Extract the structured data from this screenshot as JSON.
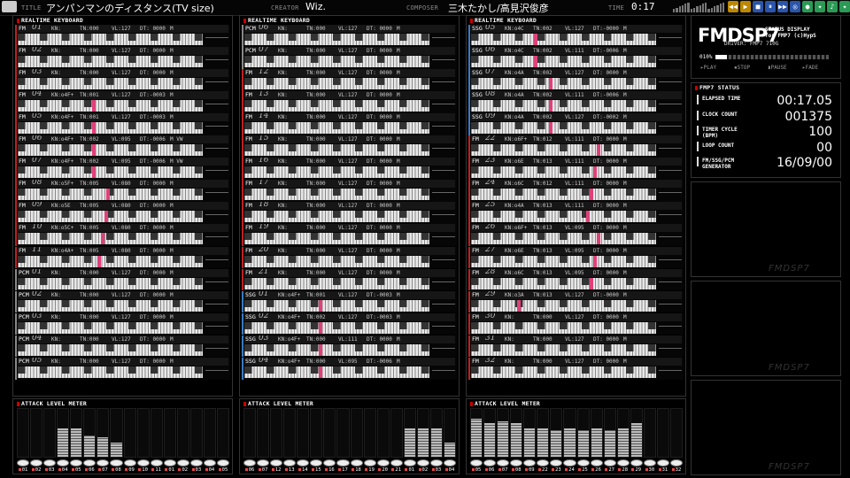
{
  "header": {
    "title_label": "TITLE",
    "title": "アンパンマンのディスタンス(TV size)",
    "creator_label": "CREATOR",
    "creator": "Wiz.",
    "composer_label": "COMPOSER",
    "composer": "三木たかし/高見沢俊彦",
    "time_label": "TIME",
    "time": "0:17"
  },
  "player_buttons": [
    "◀◀",
    "▶",
    "■",
    "⏸",
    "▶▶",
    "◎",
    "●",
    "✦",
    "♪",
    "✦",
    "▤",
    "▣",
    "✕"
  ],
  "panel_title": "REALTIME KEYBOARD",
  "meter_title": "ATTACK LEVEL METER",
  "channels": [
    [
      {
        "ch": "FM",
        "num": "01",
        "kn": "KN:",
        "tn": "TN:000",
        "vl": "VL:127",
        "dt": "DT: 0000",
        "fl": "M",
        "note": null
      },
      {
        "ch": "FM",
        "num": "02",
        "kn": "KN:",
        "tn": "TN:000",
        "vl": "VL:127",
        "dt": "DT: 0000",
        "fl": "M",
        "note": null
      },
      {
        "ch": "FM",
        "num": "03",
        "kn": "KN:",
        "tn": "TN:000",
        "vl": "VL:127",
        "dt": "DT: 0000",
        "fl": "M",
        "note": null
      },
      {
        "ch": "FM",
        "num": "04",
        "kn": "KN:o4F+",
        "tn": "TN:001",
        "vl": "VL:127",
        "dt": "DT:-0003",
        "fl": "M",
        "note": 0.4
      },
      {
        "ch": "FM",
        "num": "05",
        "kn": "KN:o4F+",
        "tn": "TN:001",
        "vl": "VL:127",
        "dt": "DT:-0003",
        "fl": "M",
        "note": 0.4
      },
      {
        "ch": "FM",
        "num": "06",
        "kn": "KN:o4F+",
        "tn": "TN:002",
        "vl": "VL:095",
        "dt": "DT:-0006",
        "fl": "M VW",
        "note": 0.4
      },
      {
        "ch": "FM",
        "num": "07",
        "kn": "KN:o4F+",
        "tn": "TN:002",
        "vl": "VL:095",
        "dt": "DT:-0006",
        "fl": "M VW",
        "note": 0.4
      },
      {
        "ch": "FM",
        "num": "08",
        "kn": "KN:o5F+",
        "tn": "TN:005",
        "vl": "VL:080",
        "dt": "DT: 0000",
        "fl": "M",
        "note": 0.48
      },
      {
        "ch": "FM",
        "num": "09",
        "kn": "KN:o5E",
        "tn": "TN:005",
        "vl": "VL:080",
        "dt": "DT: 0000",
        "fl": "M",
        "note": 0.47
      },
      {
        "ch": "FM",
        "num": "10",
        "kn": "KN:o5C+",
        "tn": "TN:005",
        "vl": "VL:080",
        "dt": "DT: 0000",
        "fl": "M",
        "note": 0.45
      },
      {
        "ch": "FM",
        "num": "11",
        "kn": "KN:o4A+",
        "tn": "TN:005",
        "vl": "VL:080",
        "dt": "DT: 0000",
        "fl": "M",
        "note": 0.43
      },
      {
        "ch": "PCM",
        "num": "01",
        "kn": "KN:",
        "tn": "TN:000",
        "vl": "VL:127",
        "dt": "DT: 0000",
        "fl": "M",
        "note": null
      },
      {
        "ch": "PCM",
        "num": "02",
        "kn": "KN:",
        "tn": "TN:000",
        "vl": "VL:127",
        "dt": "DT: 0000",
        "fl": "M",
        "note": null
      },
      {
        "ch": "PCM",
        "num": "03",
        "kn": "KN:",
        "tn": "TN:000",
        "vl": "VL:127",
        "dt": "DT: 0000",
        "fl": "M",
        "note": null
      },
      {
        "ch": "PCM",
        "num": "04",
        "kn": "KN:",
        "tn": "TN:000",
        "vl": "VL:127",
        "dt": "DT: 0000",
        "fl": "M",
        "note": null
      },
      {
        "ch": "PCM",
        "num": "05",
        "kn": "KN:",
        "tn": "TN:000",
        "vl": "VL:127",
        "dt": "DT: 0000",
        "fl": "M",
        "note": null
      }
    ],
    [
      {
        "ch": "PCM",
        "num": "06",
        "kn": "KN:",
        "tn": "TN:000",
        "vl": "VL:127",
        "dt": "DT: 0000",
        "fl": "M",
        "note": null
      },
      {
        "ch": "PCM",
        "num": "07",
        "kn": "KN:",
        "tn": "TN:000",
        "vl": "VL:127",
        "dt": "DT: 0000",
        "fl": "M",
        "note": null
      },
      {
        "ch": "FM",
        "num": "12",
        "kn": "KN:",
        "tn": "TN:000",
        "vl": "VL:127",
        "dt": "DT: 0000",
        "fl": "M",
        "note": null
      },
      {
        "ch": "FM",
        "num": "13",
        "kn": "KN:",
        "tn": "TN:000",
        "vl": "VL:127",
        "dt": "DT: 0000",
        "fl": "M",
        "note": null
      },
      {
        "ch": "FM",
        "num": "14",
        "kn": "KN:",
        "tn": "TN:000",
        "vl": "VL:127",
        "dt": "DT: 0000",
        "fl": "M",
        "note": null
      },
      {
        "ch": "FM",
        "num": "15",
        "kn": "KN:",
        "tn": "TN:000",
        "vl": "VL:127",
        "dt": "DT: 0000",
        "fl": "M",
        "note": null
      },
      {
        "ch": "FM",
        "num": "16",
        "kn": "KN:",
        "tn": "TN:000",
        "vl": "VL:127",
        "dt": "DT: 0000",
        "fl": "M",
        "note": null
      },
      {
        "ch": "FM",
        "num": "17",
        "kn": "KN:",
        "tn": "TN:000",
        "vl": "VL:127",
        "dt": "DT: 0000",
        "fl": "M",
        "note": null
      },
      {
        "ch": "FM",
        "num": "18",
        "kn": "KN:",
        "tn": "TN:000",
        "vl": "VL:127",
        "dt": "DT: 0000",
        "fl": "M",
        "note": null
      },
      {
        "ch": "FM",
        "num": "19",
        "kn": "KN:",
        "tn": "TN:000",
        "vl": "VL:127",
        "dt": "DT: 0000",
        "fl": "M",
        "note": null
      },
      {
        "ch": "FM",
        "num": "20",
        "kn": "KN:",
        "tn": "TN:000",
        "vl": "VL:127",
        "dt": "DT: 0000",
        "fl": "M",
        "note": null
      },
      {
        "ch": "FM",
        "num": "21",
        "kn": "KN:",
        "tn": "TN:000",
        "vl": "VL:127",
        "dt": "DT: 0000",
        "fl": "M",
        "note": null
      },
      {
        "ch": "SSG",
        "num": "01",
        "kn": "KN:o4F+",
        "tn": "TN:001",
        "vl": "VL:127",
        "dt": "DT:-0003",
        "fl": "M",
        "note": 0.4
      },
      {
        "ch": "SSG",
        "num": "02",
        "kn": "KN:o4F+",
        "tn": "TN:002",
        "vl": "VL:127",
        "dt": "DT:-0003",
        "fl": "M",
        "note": 0.4
      },
      {
        "ch": "SSG",
        "num": "03",
        "kn": "KN:o4F+",
        "tn": "TN:000",
        "vl": "VL:111",
        "dt": "DT: 0000",
        "fl": "M",
        "note": 0.4
      },
      {
        "ch": "SSG",
        "num": "04",
        "kn": "KN:o4F+",
        "tn": "TN:000",
        "vl": "VL:095",
        "dt": "DT:-0006",
        "fl": "M",
        "note": 0.4
      }
    ],
    [
      {
        "ch": "SSG",
        "num": "05",
        "kn": "KN:o4C",
        "tn": "TN:002",
        "vl": "VL:127",
        "dt": "DT:-0000",
        "fl": "M",
        "note": 0.34
      },
      {
        "ch": "SSG",
        "num": "06",
        "kn": "KN:o4C",
        "tn": "TN:002",
        "vl": "VL:111",
        "dt": "DT:-0006",
        "fl": "M",
        "note": 0.34
      },
      {
        "ch": "SSG",
        "num": "07",
        "kn": "KN:o4A",
        "tn": "TN:002",
        "vl": "VL:127",
        "dt": "DT: 0000",
        "fl": "M",
        "note": 0.42
      },
      {
        "ch": "SSG",
        "num": "08",
        "kn": "KN:o4A",
        "tn": "TN:002",
        "vl": "VL:111",
        "dt": "DT:-0006",
        "fl": "M",
        "note": 0.42
      },
      {
        "ch": "SSG",
        "num": "09",
        "kn": "KN:o4A",
        "tn": "TN:002",
        "vl": "VL:127",
        "dt": "DT:-0002",
        "fl": "M",
        "note": 0.42
      },
      {
        "ch": "FM",
        "num": "22",
        "kn": "KN:o6F+",
        "tn": "TN:012",
        "vl": "VL:111",
        "dt": "DT: 0000",
        "fl": "M",
        "note": 0.68
      },
      {
        "ch": "FM",
        "num": "23",
        "kn": "KN:o6E",
        "tn": "TN:013",
        "vl": "VL:111",
        "dt": "DT: 0000",
        "fl": "M",
        "note": 0.66
      },
      {
        "ch": "FM",
        "num": "24",
        "kn": "KN:o6C",
        "tn": "TN:012",
        "vl": "VL:111",
        "dt": "DT: 0000",
        "fl": "M",
        "note": 0.64
      },
      {
        "ch": "FM",
        "num": "25",
        "kn": "KN:o4A",
        "tn": "TN:013",
        "vl": "VL:111",
        "dt": "DT: 0000",
        "fl": "M",
        "note": 0.62
      },
      {
        "ch": "FM",
        "num": "26",
        "kn": "KN:o6F+",
        "tn": "TN:013",
        "vl": "VL:095",
        "dt": "DT: 0000",
        "fl": "M",
        "note": 0.68
      },
      {
        "ch": "FM",
        "num": "27",
        "kn": "KN:o6E",
        "tn": "TN:013",
        "vl": "VL:095",
        "dt": "DT: 0000",
        "fl": "M",
        "note": 0.66
      },
      {
        "ch": "FM",
        "num": "28",
        "kn": "KN:o6C",
        "tn": "TN:013",
        "vl": "VL:095",
        "dt": "DT: 0000",
        "fl": "M",
        "note": 0.64
      },
      {
        "ch": "FM",
        "num": "29",
        "kn": "KN:o3A",
        "tn": "TN:013",
        "vl": "VL:127",
        "dt": "DT:-0000",
        "fl": "M",
        "note": 0.25
      },
      {
        "ch": "FM",
        "num": "30",
        "kn": "KN:",
        "tn": "TN:000",
        "vl": "VL:127",
        "dt": "DT: 0000",
        "fl": "M",
        "note": null
      },
      {
        "ch": "FM",
        "num": "31",
        "kn": "KN:",
        "tn": "TN:000",
        "vl": "VL:127",
        "dt": "DT: 0000",
        "fl": "M",
        "note": null
      },
      {
        "ch": "FM",
        "num": "32",
        "kn": "KN:",
        "tn": "TN:000",
        "vl": "VL:127",
        "dt": "DT: 0000",
        "fl": "M",
        "note": null
      }
    ]
  ],
  "meters": [
    {
      "labels": [
        "01",
        "02",
        "03",
        "04",
        "05",
        "06",
        "07",
        "08",
        "09",
        "10",
        "11",
        "01",
        "02",
        "03",
        "04",
        "05"
      ],
      "levels": [
        0,
        0,
        0,
        0.6,
        0.6,
        0.45,
        0.4,
        0.3,
        0,
        0,
        0,
        0,
        0,
        0,
        0,
        0
      ]
    },
    {
      "labels": [
        "06",
        "07",
        "12",
        "13",
        "14",
        "15",
        "16",
        "17",
        "18",
        "19",
        "20",
        "21",
        "01",
        "02",
        "03",
        "04"
      ],
      "levels": [
        0,
        0,
        0,
        0,
        0,
        0,
        0,
        0,
        0,
        0,
        0,
        0,
        0.6,
        0.6,
        0.6,
        0.3
      ]
    },
    {
      "labels": [
        "05",
        "06",
        "07",
        "08",
        "09",
        "22",
        "23",
        "24",
        "25",
        "26",
        "27",
        "28",
        "29",
        "30",
        "31",
        "32"
      ],
      "levels": [
        0.8,
        0.7,
        0.75,
        0.7,
        0.6,
        0.6,
        0.55,
        0.6,
        0.55,
        0.6,
        0.55,
        0.6,
        0.7,
        0,
        0,
        0
      ]
    }
  ],
  "fmdsp": {
    "logo": "FMDSP7",
    "sub1": "STATUS DISPLAY",
    "sub2": "for FMP7 (c)HypS",
    "driver": "DRIVER: FMP7 710G",
    "progress": "010%",
    "progress_value": 0.1,
    "play": "▸PLAY",
    "stop": "▪STOP",
    "pause": "▮PAUSE",
    "fade": "▸FADE"
  },
  "status": {
    "title": "FMP7 STATUS",
    "items": [
      {
        "label": "ELAPSED TIME",
        "value": "00:17.05"
      },
      {
        "label": "CLOCK COUNT",
        "value": "001375"
      },
      {
        "label": "TIMER CYCLE (BPM)",
        "value": "100"
      },
      {
        "label": "LOOP COUNT",
        "value": "00"
      },
      {
        "label": "FM/SSG/PCM GENERATOR",
        "value": "16/09/00"
      }
    ]
  },
  "watermark": "FMDSP7",
  "colors": {
    "accent": "#c00000",
    "fm_marker": "#c02020",
    "ssg_marker": "#3a7ac0",
    "note": "#e0407a"
  }
}
